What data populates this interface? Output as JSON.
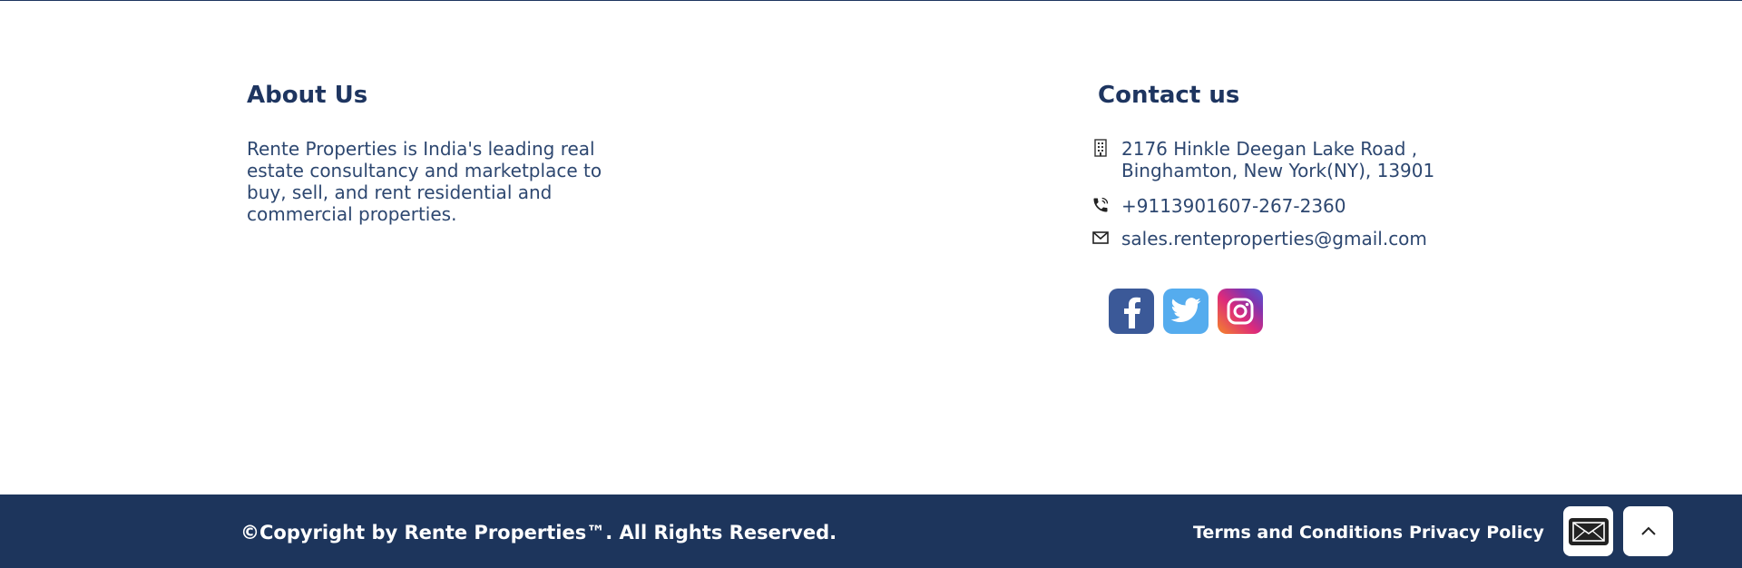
{
  "about": {
    "heading": "About Us",
    "text": "Rente Properties is India's leading real estate consultancy and marketplace to buy, sell, and rent residential and commercial properties."
  },
  "contact": {
    "heading": "Contact us",
    "address_line1": "2176 Hinkle Deegan Lake Road ,",
    "address_line2": "Binghamton, New York(NY), 13901",
    "phone": "+9113901607-267-2360",
    "email": "sales.renteproperties@gmail.com"
  },
  "social": {
    "icons": [
      "facebook-icon",
      "twitter-icon",
      "instagram-icon"
    ],
    "colors": {
      "facebook": "#3b5998",
      "twitter": "#55acee"
    }
  },
  "footer": {
    "copyright": "©Copyright by Rente Properties™. All Rights Reserved.",
    "links": {
      "terms": "Terms and Conditions",
      "privacy": "Privacy Policy"
    },
    "background": "#1d355c"
  },
  "colors": {
    "heading": "#1e3560",
    "text": "#2d4770"
  }
}
